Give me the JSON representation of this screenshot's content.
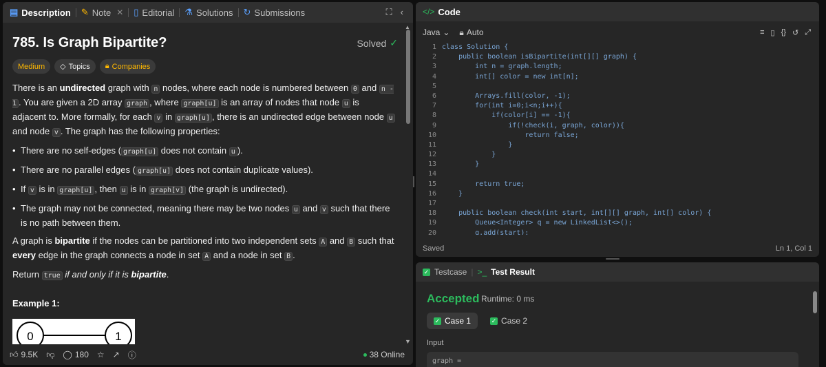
{
  "left_tabs": [
    {
      "label": "Description",
      "icon": "description-icon"
    },
    {
      "label": "Note",
      "icon": "note-icon"
    },
    {
      "label": "Editorial",
      "icon": "editorial-icon"
    },
    {
      "label": "Solutions",
      "icon": "solutions-icon"
    },
    {
      "label": "Submissions",
      "icon": "submissions-icon"
    }
  ],
  "problem": {
    "title": "785. Is Graph Bipartite?",
    "solved": "Solved",
    "difficulty": "Medium",
    "topics": "Topics",
    "companies": "Companies",
    "example_title": "Example 1:",
    "node0": "0",
    "node1": "1"
  },
  "footer": {
    "likes": "9.5K",
    "comments": "180",
    "online": "38 Online"
  },
  "code": {
    "header": "Code",
    "header_brackets": "</>",
    "language": "Java",
    "mode": "Auto",
    "status": "Saved",
    "cursor": "Ln 1, Col 1",
    "lines": [
      "class Solution {",
      "    public boolean isBipartite(int[][] graph) {",
      "        int n = graph.length;",
      "        int[] color = new int[n];",
      "",
      "        Arrays.fill(color, -1);",
      "        for(int i=0;i<n;i++){",
      "            if(color[i] == -1){",
      "                if(!check(i, graph, color)){",
      "                    return false;",
      "                }",
      "            }",
      "        }",
      "",
      "        return true;",
      "    }",
      "",
      "    public boolean check(int start, int[][] graph, int[] color) {",
      "        Queue<Integer> q = new LinkedList<>();",
      "        q.add(start);"
    ]
  },
  "test": {
    "tab_testcase": "Testcase",
    "tab_result": "Test Result",
    "result": "Accepted",
    "runtime": "Runtime: 0 ms",
    "case1": "Case 1",
    "case2": "Case 2",
    "input_label": "Input",
    "input_value": "graph ="
  },
  "colors": {
    "accent_green": "#2cbb5d",
    "medium": "#ffb800"
  }
}
